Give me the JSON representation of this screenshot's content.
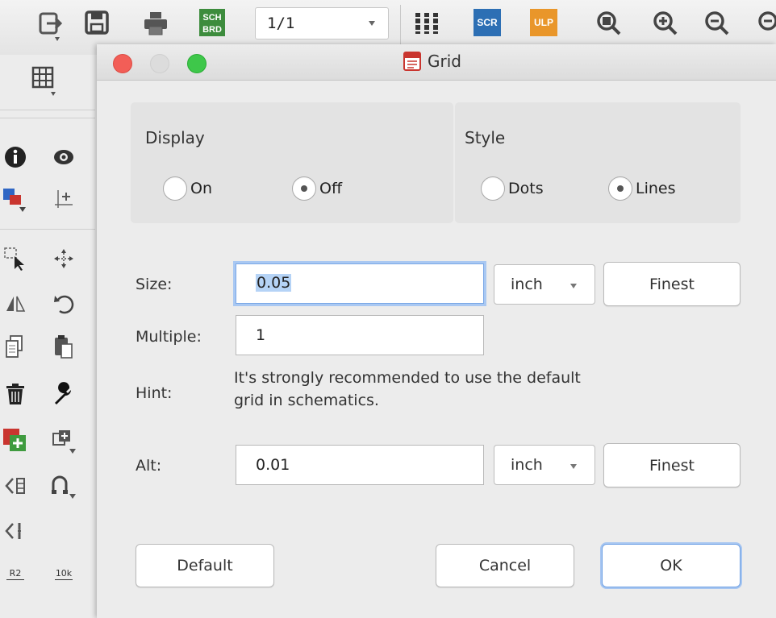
{
  "toolbar": {
    "sheet_value": "1/1",
    "icons": [
      "export-icon",
      "save-icon",
      "print-icon",
      "sch-brd-icon",
      "sheet-dropdown",
      "board-icon",
      "scr-icon",
      "ulp-icon",
      "zoom-fit-icon",
      "zoom-in-icon",
      "zoom-out-icon",
      "zoom-select-icon"
    ],
    "sch_label_top": "SCH",
    "sch_label_bottom": "BRD",
    "scr_label": "SCR",
    "ulp_label": "ULP"
  },
  "leftbar": {
    "icons": [
      "grid-icon",
      "info-icon",
      "show-icon",
      "layer-icon",
      "mark-icon",
      "move-icon",
      "group-icon",
      "mirror-icon",
      "rotate-icon",
      "copy-icon",
      "paste-icon",
      "delete-icon",
      "wrench-icon",
      "add-icon",
      "replace-icon",
      "gate-swap-icon",
      "split-icon",
      "pin-swap-icon",
      "name-icon",
      "value-icon"
    ],
    "name_label": "R2",
    "value_label": "10k"
  },
  "dialog": {
    "title": "Grid",
    "display": {
      "label": "Display",
      "options": [
        {
          "label": "On",
          "checked": false
        },
        {
          "label": "Off",
          "checked": true
        }
      ]
    },
    "style": {
      "label": "Style",
      "options": [
        {
          "label": "Dots",
          "checked": false
        },
        {
          "label": "Lines",
          "checked": true
        }
      ]
    },
    "size": {
      "label": "Size:",
      "value": "0.05",
      "unit": "inch",
      "finest_label": "Finest"
    },
    "multiple": {
      "label": "Multiple:",
      "value": "1"
    },
    "hint": {
      "label": "Hint:",
      "line1": "It's strongly recommended to use the default",
      "line2": "grid in schematics."
    },
    "alt": {
      "label": "Alt:",
      "value": "0.01",
      "unit": "inch",
      "finest_label": "Finest"
    },
    "buttons": {
      "default_label": "Default",
      "cancel_label": "Cancel",
      "ok_label": "OK"
    }
  },
  "colors": {
    "close": "#f25e57",
    "maximize": "#3ec74a",
    "focus_ring": "#a9c8f2",
    "selection": "#b5d3f6"
  }
}
